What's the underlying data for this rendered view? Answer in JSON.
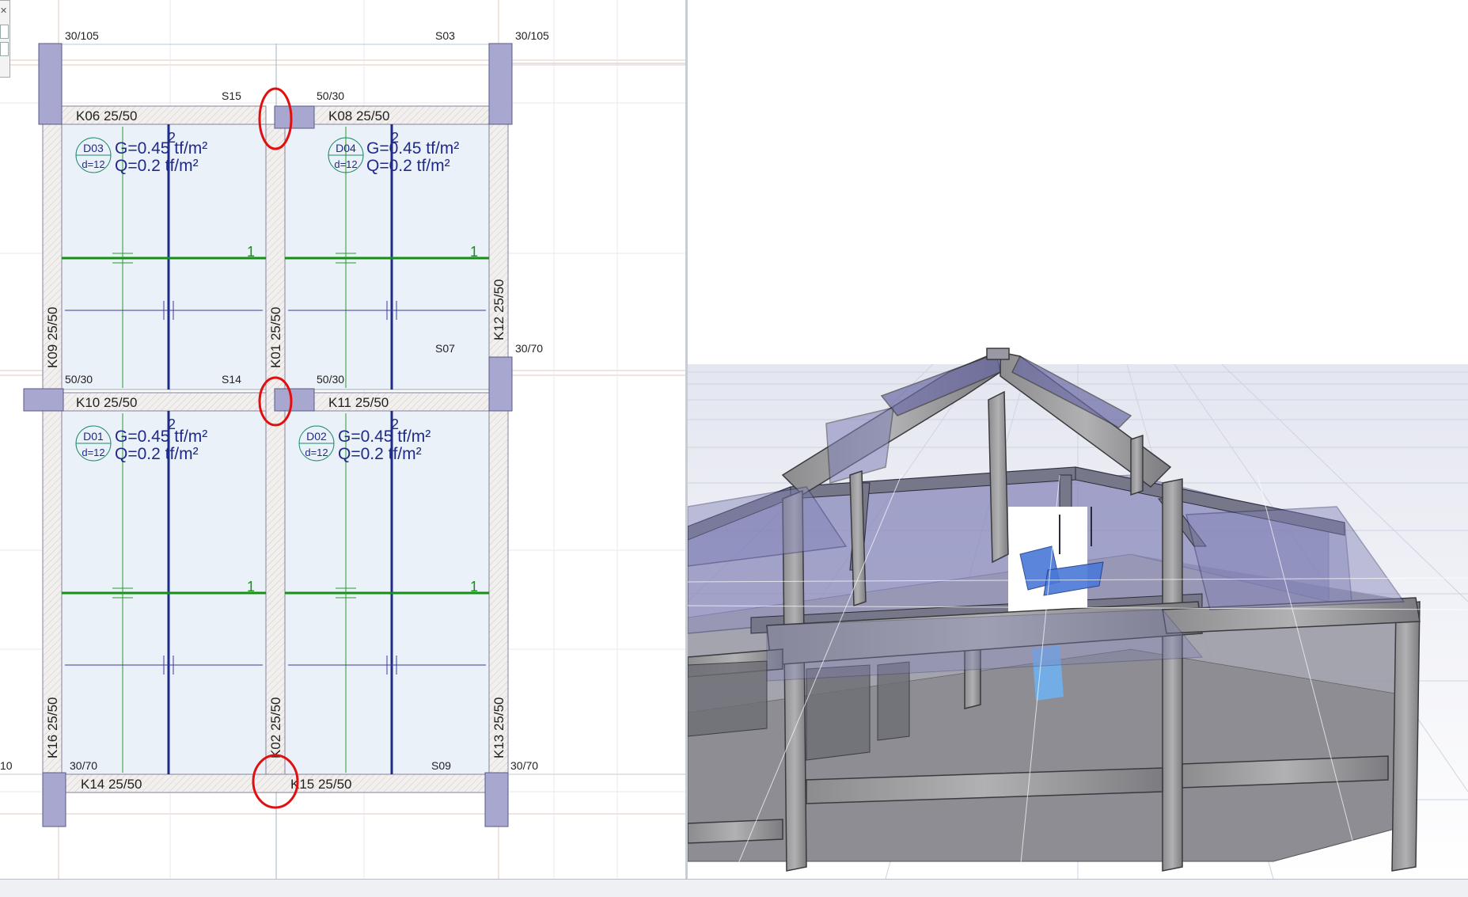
{
  "plan": {
    "columns": {
      "top_left": "30/105",
      "top_right": "30/105",
      "mid_right": "30/70",
      "mid_left": "50/30",
      "mid_center": "50/30",
      "top_center": "50/30",
      "bottom_left": "30/70",
      "bottom_right": "30/70"
    },
    "column_ids": {
      "s03": "S03",
      "s15": "S15",
      "s14": "S14",
      "s07": "S07",
      "s09": "S09",
      "edge": "10"
    },
    "beams": {
      "k06": "K06 25/50",
      "k08": "K08 25/50",
      "k10": "K10 25/50",
      "k11": "K11 25/50",
      "k14": "K14 25/50",
      "k15": "K15 25/50",
      "k09": "K09 25/50",
      "k01": "K01 25/50",
      "k12": "K12 25/50",
      "k16": "K16 25/50",
      "k02": "K02 25/50",
      "k13": "K13 25/50"
    },
    "slabs": [
      {
        "id": "D03",
        "thickness": "d=12",
        "g": "G=0.45 tf/m²",
        "q": "Q=0.2 tf/m²"
      },
      {
        "id": "D04",
        "thickness": "d=12",
        "g": "G=0.45 tf/m²",
        "q": "Q=0.2 tf/m²"
      },
      {
        "id": "D01",
        "thickness": "d=12",
        "g": "G=0.45 tf/m²",
        "q": "Q=0.2 tf/m²"
      },
      {
        "id": "D02",
        "thickness": "d=12",
        "g": "G=0.45 tf/m²",
        "q": "Q=0.2 tf/m²"
      }
    ],
    "axis_marks": {
      "two": "2",
      "one": "1"
    },
    "colors": {
      "slab_fill": "#eaf1f8",
      "beam_fill": "#f2f0ee",
      "column_fill": "#a7a7cf",
      "load_text": "#1f2a8a",
      "green_line": "#159015",
      "highlight_red": "#e01010"
    }
  },
  "view3d": {
    "icons": [
      "3d-model-render"
    ]
  }
}
